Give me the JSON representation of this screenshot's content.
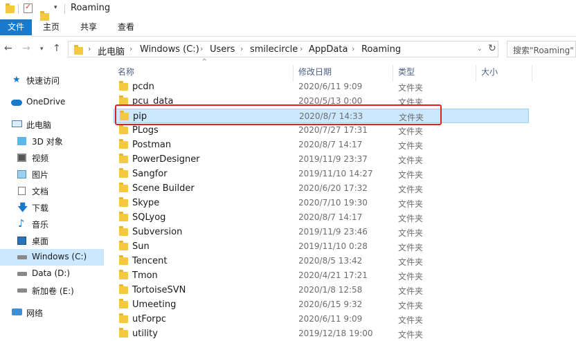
{
  "window": {
    "title": "Roaming"
  },
  "ribbon": {
    "tabs": [
      "文件",
      "主页",
      "共享",
      "查看"
    ]
  },
  "address": {
    "crumbs": [
      "此电脑",
      "Windows (C:)",
      "Users",
      "smilecircle",
      "AppData",
      "Roaming"
    ],
    "search_placeholder": "搜索\"Roaming\""
  },
  "nav": {
    "items": [
      {
        "label": "快速访问",
        "icon": "star-icon"
      },
      {
        "label": "OneDrive",
        "icon": "cloud-icon"
      },
      {
        "label": "此电脑",
        "icon": "computer-icon"
      },
      {
        "label": "3D 对象",
        "icon": "cube-icon"
      },
      {
        "label": "视频",
        "icon": "video-icon"
      },
      {
        "label": "图片",
        "icon": "picture-icon"
      },
      {
        "label": "文档",
        "icon": "document-icon"
      },
      {
        "label": "下载",
        "icon": "download-icon"
      },
      {
        "label": "音乐",
        "icon": "music-icon"
      },
      {
        "label": "桌面",
        "icon": "desktop-icon"
      },
      {
        "label": "Windows (C:)",
        "icon": "drive-icon"
      },
      {
        "label": "Data (D:)",
        "icon": "drive-icon"
      },
      {
        "label": "新加卷 (E:)",
        "icon": "drive-icon"
      },
      {
        "label": "网络",
        "icon": "network-icon"
      }
    ],
    "selected": "Windows (C:)"
  },
  "columns": {
    "name": "名称",
    "date": "修改日期",
    "type": "类型",
    "size": "大小"
  },
  "files": [
    {
      "name": "pcdn",
      "date": "2020/6/11 9:09",
      "type": "文件夹"
    },
    {
      "name": "pcu_data",
      "date": "2020/5/13 0:00",
      "type": "文件夹"
    },
    {
      "name": "pip",
      "date": "2020/8/7 14:33",
      "type": "文件夹"
    },
    {
      "name": "PLogs",
      "date": "2020/7/27 17:31",
      "type": "文件夹"
    },
    {
      "name": "Postman",
      "date": "2020/8/7 14:17",
      "type": "文件夹"
    },
    {
      "name": "PowerDesigner",
      "date": "2019/11/9 23:37",
      "type": "文件夹"
    },
    {
      "name": "Sangfor",
      "date": "2019/11/10 14:27",
      "type": "文件夹"
    },
    {
      "name": "Scene Builder",
      "date": "2020/6/20 17:32",
      "type": "文件夹"
    },
    {
      "name": "Skype",
      "date": "2020/7/10 19:30",
      "type": "文件夹"
    },
    {
      "name": "SQLyog",
      "date": "2020/8/7 14:17",
      "type": "文件夹"
    },
    {
      "name": "Subversion",
      "date": "2019/11/9 23:46",
      "type": "文件夹"
    },
    {
      "name": "Sun",
      "date": "2019/11/10 0:28",
      "type": "文件夹"
    },
    {
      "name": "Tencent",
      "date": "2020/8/5 13:42",
      "type": "文件夹"
    },
    {
      "name": "Tmon",
      "date": "2020/4/21 17:21",
      "type": "文件夹"
    },
    {
      "name": "TortoiseSVN",
      "date": "2020/1/8 12:58",
      "type": "文件夹"
    },
    {
      "name": "Umeeting",
      "date": "2020/6/15 9:32",
      "type": "文件夹"
    },
    {
      "name": "utForpc",
      "date": "2020/6/11 9:09",
      "type": "文件夹"
    },
    {
      "name": "utility",
      "date": "2019/12/18 19:00",
      "type": "文件夹"
    }
  ],
  "selected_file": "pip",
  "colors": {
    "accent": "#1979ca",
    "selection": "#cce8ff",
    "highlight": "#e02020"
  }
}
